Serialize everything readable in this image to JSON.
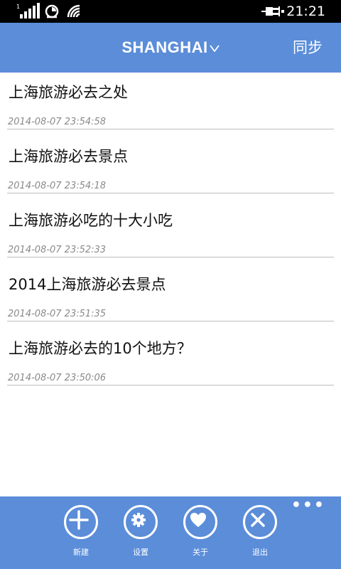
{
  "status_bar": {
    "time": "21:21",
    "signal_icon": "signal-bars-icon",
    "sync_icon": "sync-icon",
    "wifi_icon": "wifi-icon",
    "battery_icon": "battery-charging-icon"
  },
  "header": {
    "title": "SHANGHAI",
    "dropdown_icon": "chevron-down-icon",
    "sync_label": "同步"
  },
  "list": [
    {
      "title": "上海旅游必去之处",
      "date": "2014-08-07 23:54:58"
    },
    {
      "title": "上海旅游必去景点",
      "date": "2014-08-07 23:54:18"
    },
    {
      "title": "上海旅游必吃的十大小吃",
      "date": "2014-08-07 23:52:33"
    },
    {
      "title": "2014上海旅游必去景点",
      "date": "2014-08-07 23:51:35"
    },
    {
      "title": "上海旅游必去的10个地方？",
      "date": "2014-08-07 23:50:06"
    }
  ],
  "app_bar": {
    "more_label": "•••",
    "buttons": [
      {
        "label": "新建",
        "icon": "add-icon"
      },
      {
        "label": "设置",
        "icon": "gear-icon"
      },
      {
        "label": "关于",
        "icon": "heart-icon"
      },
      {
        "label": "退出",
        "icon": "close-icon"
      }
    ]
  },
  "colors": {
    "accent": "#5b8dd9",
    "status_bar": "#000000",
    "date_text": "#8a8a8a"
  }
}
